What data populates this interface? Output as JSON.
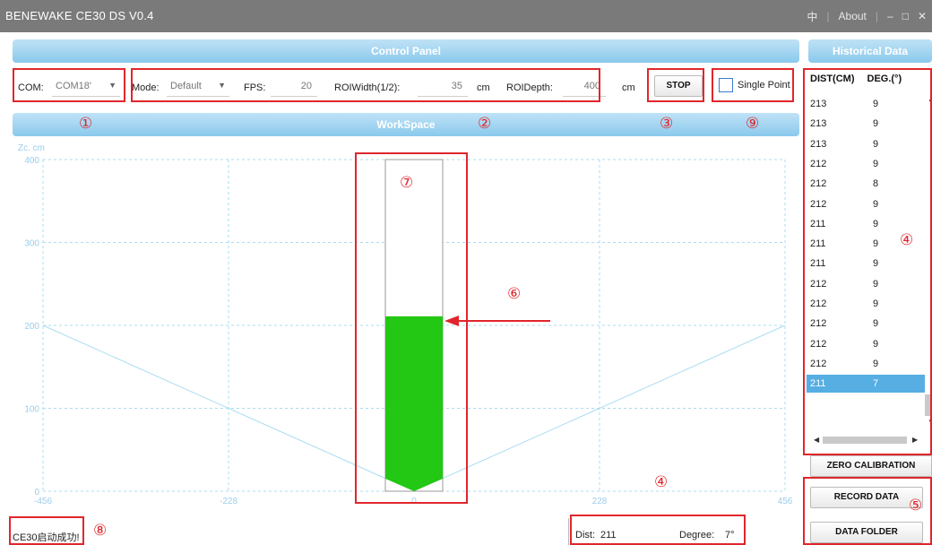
{
  "window": {
    "title": "BENEWAKE CE30 DS V0.4",
    "language_glyph": "中",
    "about_label": "About",
    "minimize_glyph": "‒",
    "maximize_glyph": "□",
    "close_glyph": "✕"
  },
  "control_panel": {
    "header": "Control Panel",
    "com_label": "COM:",
    "com_value": "COM18'",
    "mode_label": "Mode:",
    "mode_value": "Default",
    "fps_label": "FPS:",
    "fps_value": "20",
    "roi_width_label": "ROIWidth(1/2):",
    "roi_width_value": "35",
    "roi_width_unit": "cm",
    "roi_depth_label": "ROIDepth:",
    "roi_depth_value": "400",
    "roi_depth_unit": "cm",
    "stop_label": "STOP",
    "single_point_label": "Single Point",
    "single_point_checked": false
  },
  "workspace": {
    "header": "WorkSpace",
    "y_unit_label": "Zc. cm"
  },
  "historical": {
    "header": "Historical Data",
    "col_dist": "DIST(CM)",
    "col_deg": "DEG.(°)",
    "rows": [
      {
        "dist": "213",
        "deg": "9"
      },
      {
        "dist": "213",
        "deg": "9"
      },
      {
        "dist": "213",
        "deg": "9"
      },
      {
        "dist": "212",
        "deg": "9"
      },
      {
        "dist": "212",
        "deg": "8"
      },
      {
        "dist": "212",
        "deg": "9"
      },
      {
        "dist": "211",
        "deg": "9"
      },
      {
        "dist": "211",
        "deg": "9"
      },
      {
        "dist": "211",
        "deg": "9"
      },
      {
        "dist": "212",
        "deg": "9"
      },
      {
        "dist": "212",
        "deg": "9"
      },
      {
        "dist": "212",
        "deg": "9"
      },
      {
        "dist": "212",
        "deg": "9"
      },
      {
        "dist": "212",
        "deg": "9"
      },
      {
        "dist": "211",
        "deg": "7"
      }
    ],
    "selected_index": 14
  },
  "buttons": {
    "zero_calibration": "ZERO CALIBRATION",
    "record_data": "RECORD DATA",
    "data_folder": "DATA FOLDER"
  },
  "status": {
    "message": "CE30启动成功!",
    "dist_label": "Dist:",
    "dist_value": "211",
    "degree_label": "Degree:",
    "degree_value": "7°"
  },
  "annotations": {
    "n1": "①",
    "n2": "②",
    "n3": "③",
    "n4": "④",
    "n5": "⑤",
    "n6": "⑥",
    "n7": "⑦",
    "n8": "⑧",
    "n9": "⑨"
  },
  "colors": {
    "annotation_red": "#e0262c",
    "bar_green": "#22c814",
    "grid_blue": "#a9dcf3",
    "selected_row": "#56aee3"
  },
  "chart_data": {
    "type": "bar",
    "x_ticks": [
      "-456",
      "-228",
      "0",
      "228",
      "456"
    ],
    "y_ticks": [
      "0",
      "100",
      "200",
      "300",
      "400"
    ],
    "xlim": [
      -456,
      456
    ],
    "ylim": [
      0,
      400
    ],
    "ylabel": "Zc. cm",
    "bar_value": 211,
    "bar_max": 400,
    "fov_lines": [
      {
        "x": [
          -456,
          0
        ],
        "y": [
          200,
          0
        ]
      },
      {
        "x": [
          0,
          456
        ],
        "y": [
          0,
          200
        ]
      }
    ]
  }
}
